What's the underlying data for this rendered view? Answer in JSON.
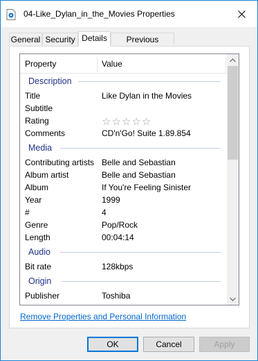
{
  "window": {
    "title": "04-Like_Dylan_in_the_Movies Properties",
    "icon": "audio-file-icon"
  },
  "tabs": [
    {
      "label": "General",
      "active": false
    },
    {
      "label": "Security",
      "active": false
    },
    {
      "label": "Details",
      "active": true
    },
    {
      "label": "Previous Versions",
      "active": false
    }
  ],
  "details": {
    "header": {
      "property": "Property",
      "value": "Value"
    },
    "groups": {
      "description": {
        "title": "Description",
        "rows": [
          {
            "name": "Title",
            "value": "Like Dylan in the Movies"
          },
          {
            "name": "Subtitle",
            "value": ""
          },
          {
            "name": "Rating",
            "value": "☆☆☆☆☆",
            "stars": 0
          },
          {
            "name": "Comments",
            "value": "CD'n'Go! Suite 1.89.854"
          }
        ]
      },
      "media": {
        "title": "Media",
        "rows": [
          {
            "name": "Contributing artists",
            "value": "Belle and Sebastian"
          },
          {
            "name": "Album artist",
            "value": "Belle and Sebastian"
          },
          {
            "name": "Album",
            "value": "If You're Feeling Sinister"
          },
          {
            "name": "Year",
            "value": "1999"
          },
          {
            "name": "#",
            "value": "4"
          },
          {
            "name": "Genre",
            "value": "Pop/Rock"
          },
          {
            "name": "Length",
            "value": "00:04:14"
          }
        ]
      },
      "audio": {
        "title": "Audio",
        "rows": [
          {
            "name": "Bit rate",
            "value": "128kbps"
          }
        ]
      },
      "origin": {
        "title": "Origin",
        "rows": [
          {
            "name": "Publisher",
            "value": "Toshiba"
          }
        ]
      }
    }
  },
  "remove_link": "Remove Properties and Personal Information",
  "buttons": {
    "ok": "OK",
    "cancel": "Cancel",
    "apply": "Apply"
  },
  "colors": {
    "accent": "#0078d7",
    "group_title": "#1e3287",
    "link": "#0066cc"
  }
}
